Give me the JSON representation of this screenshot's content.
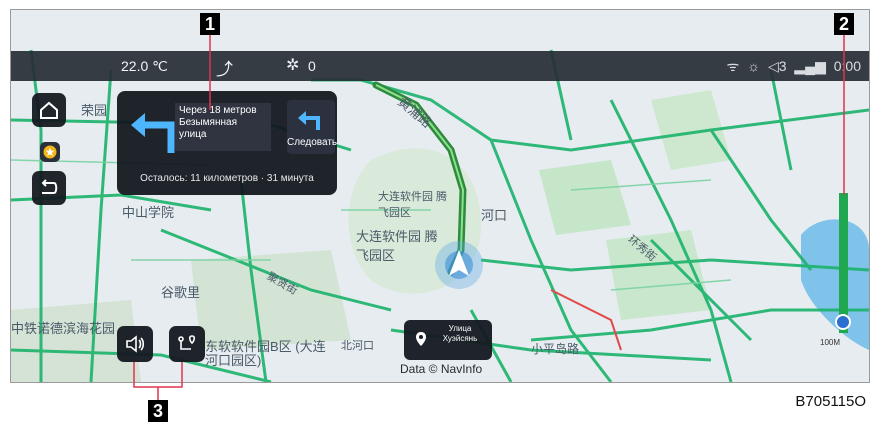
{
  "status_bar": {
    "temperature": "22.0 ℃",
    "fan_level": "0",
    "volume": "◁3",
    "time": "0:00"
  },
  "nav_card": {
    "instruction": "Через 18 метров Безымянная улица",
    "follow_label": "Следовать",
    "remaining": "Осталось: 11 километров · 31 минута"
  },
  "poi": {
    "name": "Улица Хуэйсянь"
  },
  "map_labels": {
    "huangpu_road": "黄浦路",
    "software_park_area": "大连软件园 腾飞园区",
    "software_park_big": "大连软件园 腾飞园区",
    "zhongshan_college": "中山学院",
    "gugeli": "谷歌里",
    "hekou": "河口",
    "rongyuan": "荣园",
    "sinotrans_garden": "中铁诺德滨海花园",
    "dongruan_park": "东软软件园B区 (大连河口园区)",
    "north_river": "北河口",
    "xiaoping_road": "小平岛路",
    "juxian_street": "聚贤街",
    "huanxiu_street": "环秀街"
  },
  "data_credit": "Data © NavInfo",
  "scale_text": "100M",
  "callouts": [
    "1",
    "2",
    "3"
  ],
  "figure_code": "B705115O",
  "colors": {
    "map_bg": "#e6ecef",
    "road": "#1bb36b",
    "route": "#2e8b3e",
    "water": "#79c0e8",
    "park": "#bfe2c4",
    "status_bar": "#262c34",
    "panel": "#12161e"
  }
}
